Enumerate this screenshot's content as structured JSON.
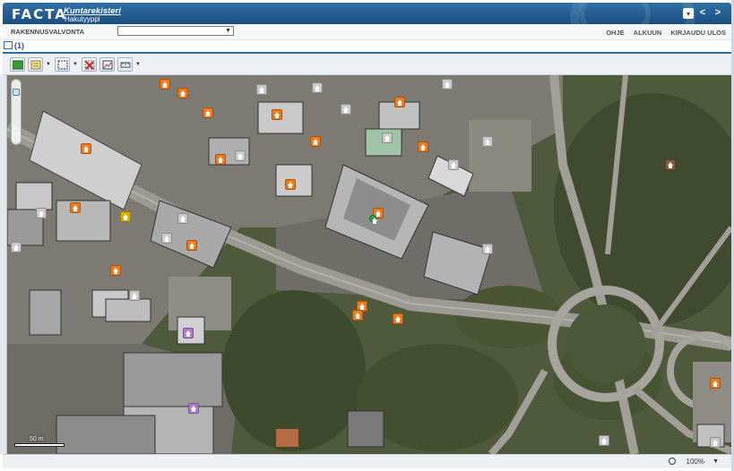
{
  "header": {
    "logo": "FACTA",
    "app_name": "Kuntarekisteri",
    "app_sub": "Hakutyyppi",
    "controls": [
      "▾",
      "<",
      ">"
    ]
  },
  "navbar": {
    "module_label": "RAKENNUSVALVONTA",
    "module_select_value": "",
    "links": [
      "OHJE",
      "ALKUUN",
      "KIRJAUDU ULOS"
    ]
  },
  "tab": {
    "label": "(1)"
  },
  "toolbar": {
    "tools": [
      "map-layers-icon",
      "legend-icon",
      "select-area-icon",
      "clear-selection-icon",
      "print-map-icon",
      "measure-icon"
    ]
  },
  "map": {
    "scale_label": "50 m",
    "marker_colors": {
      "orange": "#f07a1c",
      "gray": "#c9c9c9",
      "yellow": "#d8b000",
      "purple": "#b07ac8",
      "brown": "#8c5a3c",
      "green": "#2aa04a"
    }
  },
  "statusbar": {
    "zoom_level": "100%"
  }
}
